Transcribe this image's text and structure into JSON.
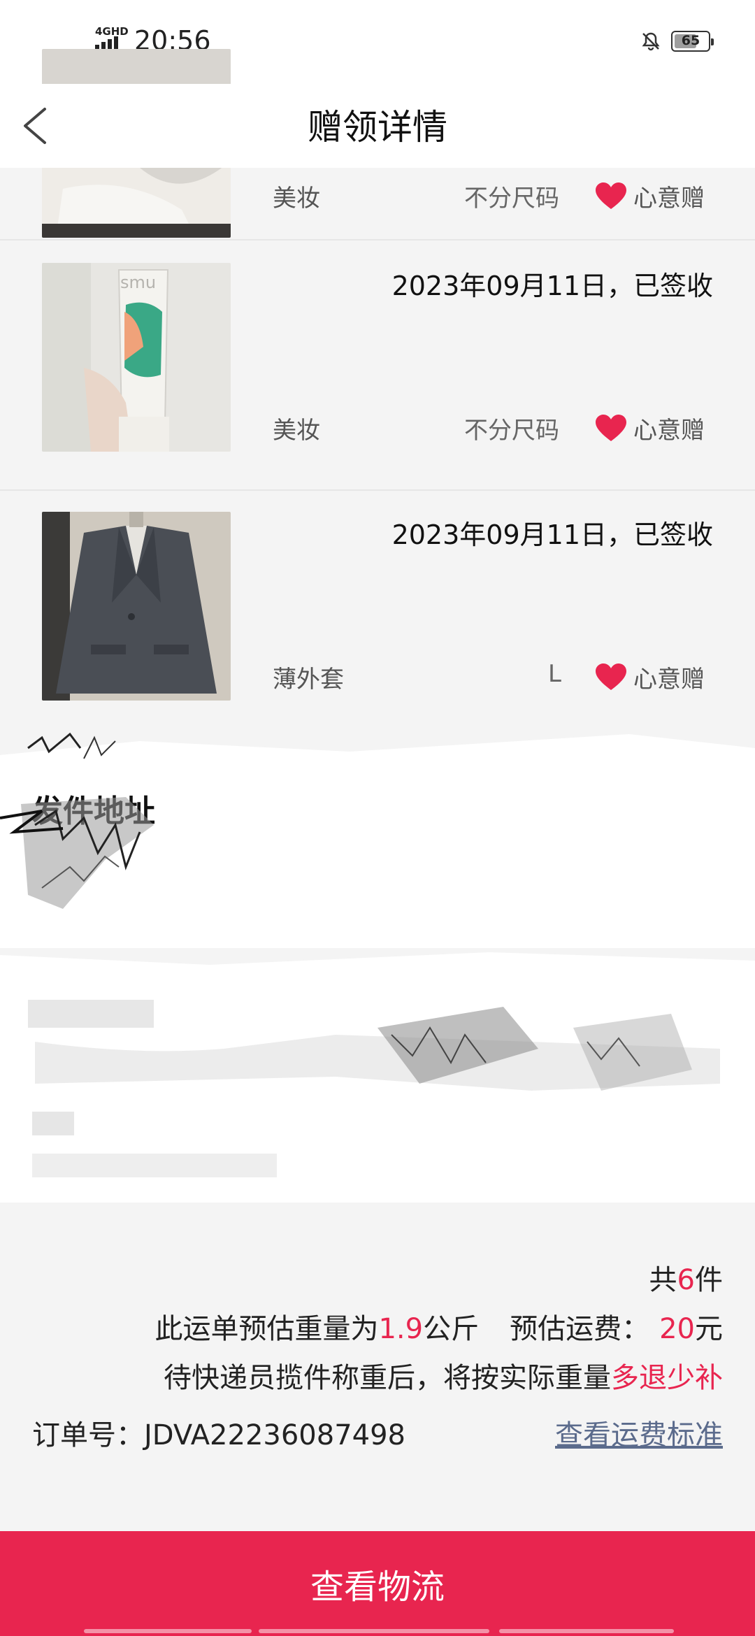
{
  "status_bar": {
    "network": "4GHD",
    "time": "20:56",
    "battery": "65"
  },
  "nav": {
    "title": "赠领详情"
  },
  "gifts": [
    {
      "date": "",
      "category": "美妆",
      "size": "不分尺码",
      "gift_type": "心意赠",
      "thumb_icon": "white-cloth-photo"
    },
    {
      "date": "2023年09月11日，已签收",
      "category": "美妆",
      "size": "不分尺码",
      "gift_type": "心意赠",
      "thumb_icon": "cosmetic-tube-photo",
      "brand_text": "smu"
    },
    {
      "date": "2023年09月11日，已签收",
      "category": "薄外套",
      "size": "L",
      "gift_type": "心意赠",
      "thumb_icon": "grey-jacket-photo"
    }
  ],
  "sender": {
    "title": "发件地址"
  },
  "summary": {
    "count_prefix": "共",
    "count": "6",
    "count_suffix": "件",
    "weight_prefix": "此运单预估重量为",
    "weight": "1.9",
    "weight_unit": "公斤",
    "fee_label": "预估运费：",
    "fee": "20",
    "fee_unit": "元",
    "note_prefix": "待快递员揽件称重后，将按实际重量",
    "note_highlight": "多退少补",
    "order_label": "订单号：JDVA22236087498",
    "fee_standard_link": "查看运费标准"
  },
  "bottom_button": {
    "label": "查看物流"
  },
  "colors": {
    "accent": "#e8254f",
    "link": "#5b6b8c",
    "background": "#f4f4f4"
  }
}
